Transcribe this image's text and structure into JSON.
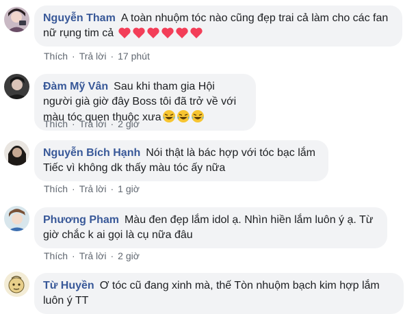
{
  "comments": [
    {
      "author": "Nguyễn Tham",
      "text": "A toàn nhuộm tóc nào cũng đẹp trai cả làm cho các fan nữ rụng tim cả",
      "emoji_count": 6,
      "emoji_icon": "heart-icon",
      "like": "Thích",
      "reply": "Trả lời",
      "time": "17 phút"
    },
    {
      "author": "Đàm Mỹ Vân",
      "text": "Sau khi tham gia Hội người già giờ đây Boss tôi đã trở về với màu tóc quen thuộc xưa",
      "emoji_count": 3,
      "emoji_icon": "laughing-tears-icon",
      "like": "Thích",
      "reply": "Trả lời",
      "time": "2 giờ"
    },
    {
      "author": "Nguyễn Bích Hạnh",
      "text": "Nói thật là bác hợp với tóc bạc lắm Tiếc vì không dk thấy màu tóc ấy nữa",
      "like": "Thích",
      "reply": "Trả lời",
      "time": "1 giờ"
    },
    {
      "author": "Phương Pham",
      "text": "Màu đen đẹp lắm idol ạ. Nhìn hiền lắm luôn ý ạ. Từ giờ chắc k ai gọi là cụ nữa đâu",
      "like": "Thích",
      "reply": "Trả lời",
      "time": "2 giờ"
    },
    {
      "author": "Từ Huyền",
      "text": "Ơ tóc cũ đang xinh mà, thế Tòn nhuộm bạch kim hợp lắm luôn ý TT"
    }
  ],
  "separator": "·",
  "colors": {
    "author": "#385898",
    "bubble": "#f2f3f5",
    "meta": "#606770",
    "heart": "#f33e58"
  }
}
